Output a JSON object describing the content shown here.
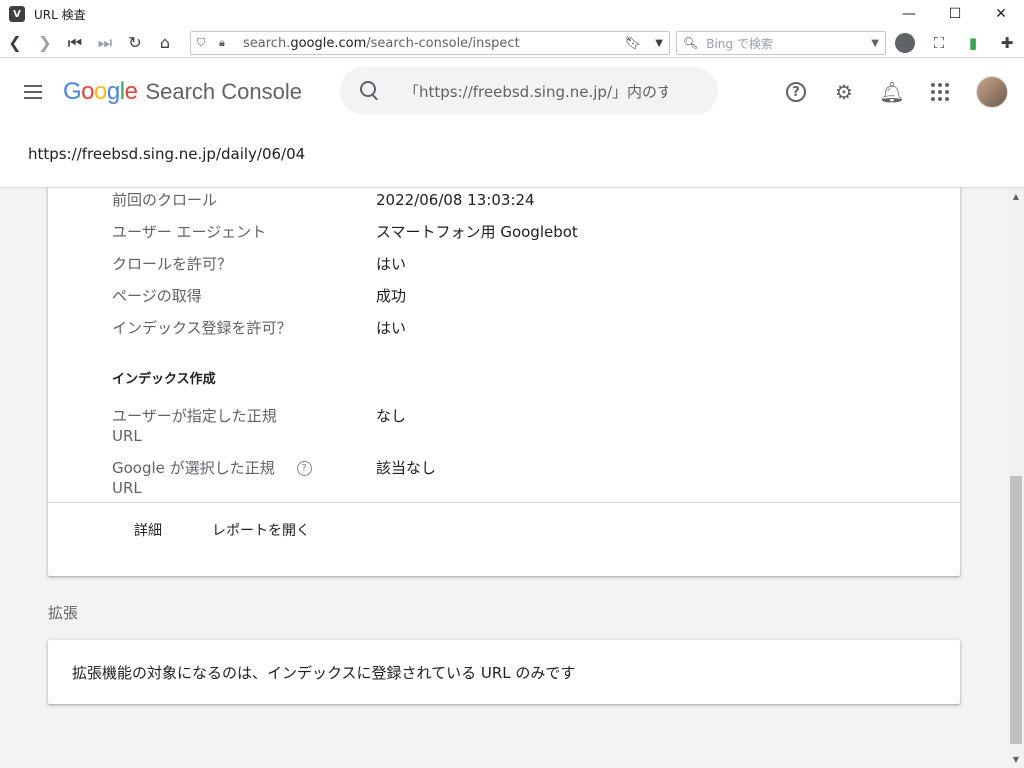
{
  "window": {
    "title": "URL 検査",
    "app_icon": "V",
    "controls": [
      "minimize-icon",
      "maximize-icon",
      "close-icon"
    ]
  },
  "browser": {
    "url_prefix": "search.",
    "url_domain": "google.com",
    "url_path": "/search-console/inspect",
    "search_placeholder": "Bing で検索",
    "icons": [
      "back-icon",
      "forward-icon",
      "rewind-icon",
      "fast-forward-icon",
      "reload-icon",
      "home-icon",
      "shield-icon",
      "lock-icon",
      "bookmark-icon",
      "profile-icon",
      "capture-icon",
      "bookmark-green-icon",
      "extensions-icon"
    ]
  },
  "app": {
    "logo_google": "Google",
    "logo_product": "Search Console",
    "search_query": "「https://freebsd.sing.ne.jp/」内のす",
    "inspected_url": "https://freebsd.sing.ne.jp/daily/06/04"
  },
  "crawl": {
    "rows": [
      {
        "key": "前回のクロール",
        "value": "2022/06/08 13:03:24"
      },
      {
        "key": "ユーザー エージェント",
        "value": "スマートフォン用 Googlebot"
      },
      {
        "key": "クロールを許可？",
        "value": "はい"
      },
      {
        "key": "ページの取得",
        "value": "成功"
      },
      {
        "key": "インデックス登録を許可？",
        "value": "はい"
      }
    ]
  },
  "indexing": {
    "heading": "インデックス作成",
    "user_canonical_key_1": "ユーザーが指定した正規",
    "user_canonical_key_2": "URL",
    "user_canonical_value": "なし",
    "google_canonical_key_1": "Google が選択した正規",
    "google_canonical_key_2": "URL",
    "google_canonical_help": "?",
    "google_canonical_value": "該当なし"
  },
  "footer": {
    "details": "詳細",
    "open_report": "レポートを開く"
  },
  "enhancements": {
    "heading": "拡張",
    "message": "拡張機能の対象になるのは、インデックスに登録されている URL のみです"
  }
}
